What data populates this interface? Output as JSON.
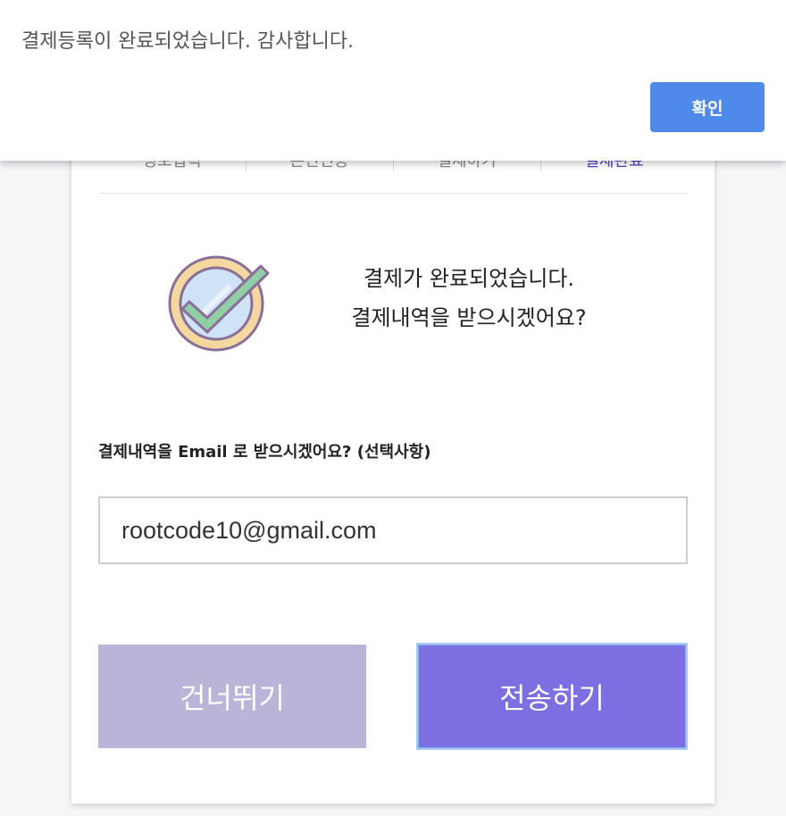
{
  "alert": {
    "message": "결제등록이 완료되었습니다. 감사합니다.",
    "ok_label": "확인",
    "ok_color": "#4f8aea"
  },
  "steps": [
    {
      "label": "정보입력"
    },
    {
      "label": "본인인증"
    },
    {
      "label": "결제하기"
    },
    {
      "label": "결제완료"
    }
  ],
  "success": {
    "line1": "결제가 완료되었습니다.",
    "line2": "결제내역을 받으시겠어요?",
    "icon": "check-circle-icon"
  },
  "email": {
    "label": "결제내역을 Email 로 받으시겠어요? (선택사항)",
    "value": "rootcode10@gmail.com"
  },
  "buttons": {
    "skip_label": "건너뛰기",
    "send_label": "전송하기",
    "skip_color": "#bcb4d8",
    "send_color": "#7d6fe2"
  }
}
